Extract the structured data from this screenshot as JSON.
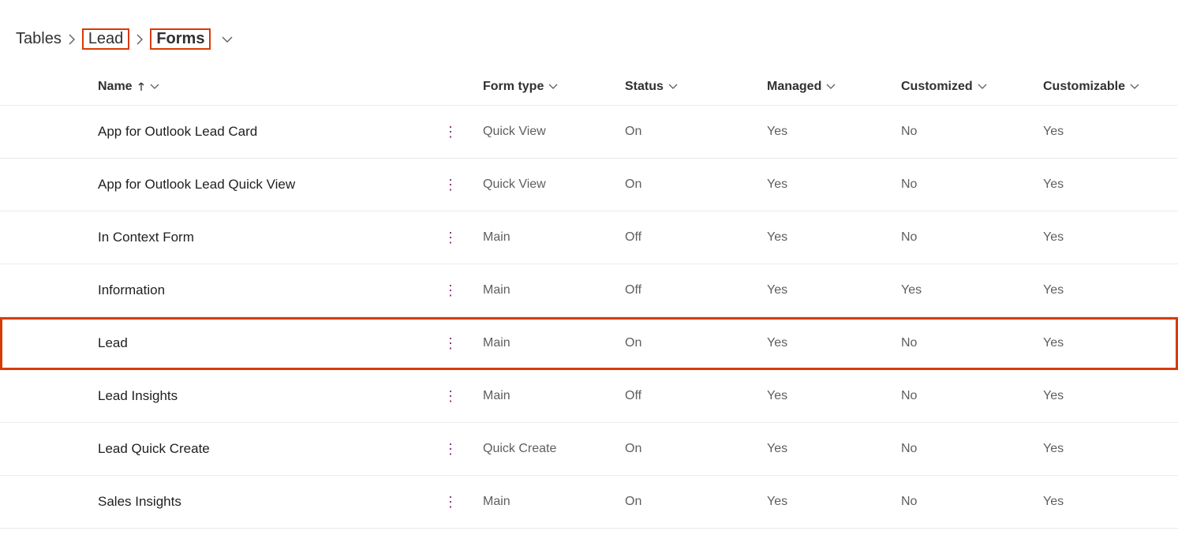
{
  "breadcrumb": {
    "root": "Tables",
    "mid": "Lead",
    "current": "Forms"
  },
  "columns": {
    "name": "Name",
    "form_type": "Form type",
    "status": "Status",
    "managed": "Managed",
    "customized": "Customized",
    "customizable": "Customizable"
  },
  "rows": [
    {
      "name": "App for Outlook Lead Card",
      "form_type": "Quick View",
      "status": "On",
      "managed": "Yes",
      "customized": "No",
      "customizable": "Yes"
    },
    {
      "name": "App for Outlook Lead Quick View",
      "form_type": "Quick View",
      "status": "On",
      "managed": "Yes",
      "customized": "No",
      "customizable": "Yes"
    },
    {
      "name": "In Context Form",
      "form_type": "Main",
      "status": "Off",
      "managed": "Yes",
      "customized": "No",
      "customizable": "Yes"
    },
    {
      "name": "Information",
      "form_type": "Main",
      "status": "Off",
      "managed": "Yes",
      "customized": "Yes",
      "customizable": "Yes"
    },
    {
      "name": "Lead",
      "form_type": "Main",
      "status": "On",
      "managed": "Yes",
      "customized": "No",
      "customizable": "Yes"
    },
    {
      "name": "Lead Insights",
      "form_type": "Main",
      "status": "Off",
      "managed": "Yes",
      "customized": "No",
      "customizable": "Yes"
    },
    {
      "name": "Lead Quick Create",
      "form_type": "Quick Create",
      "status": "On",
      "managed": "Yes",
      "customized": "No",
      "customizable": "Yes"
    },
    {
      "name": "Sales Insights",
      "form_type": "Main",
      "status": "On",
      "managed": "Yes",
      "customized": "No",
      "customizable": "Yes"
    }
  ],
  "highlighted_row_index": 4
}
